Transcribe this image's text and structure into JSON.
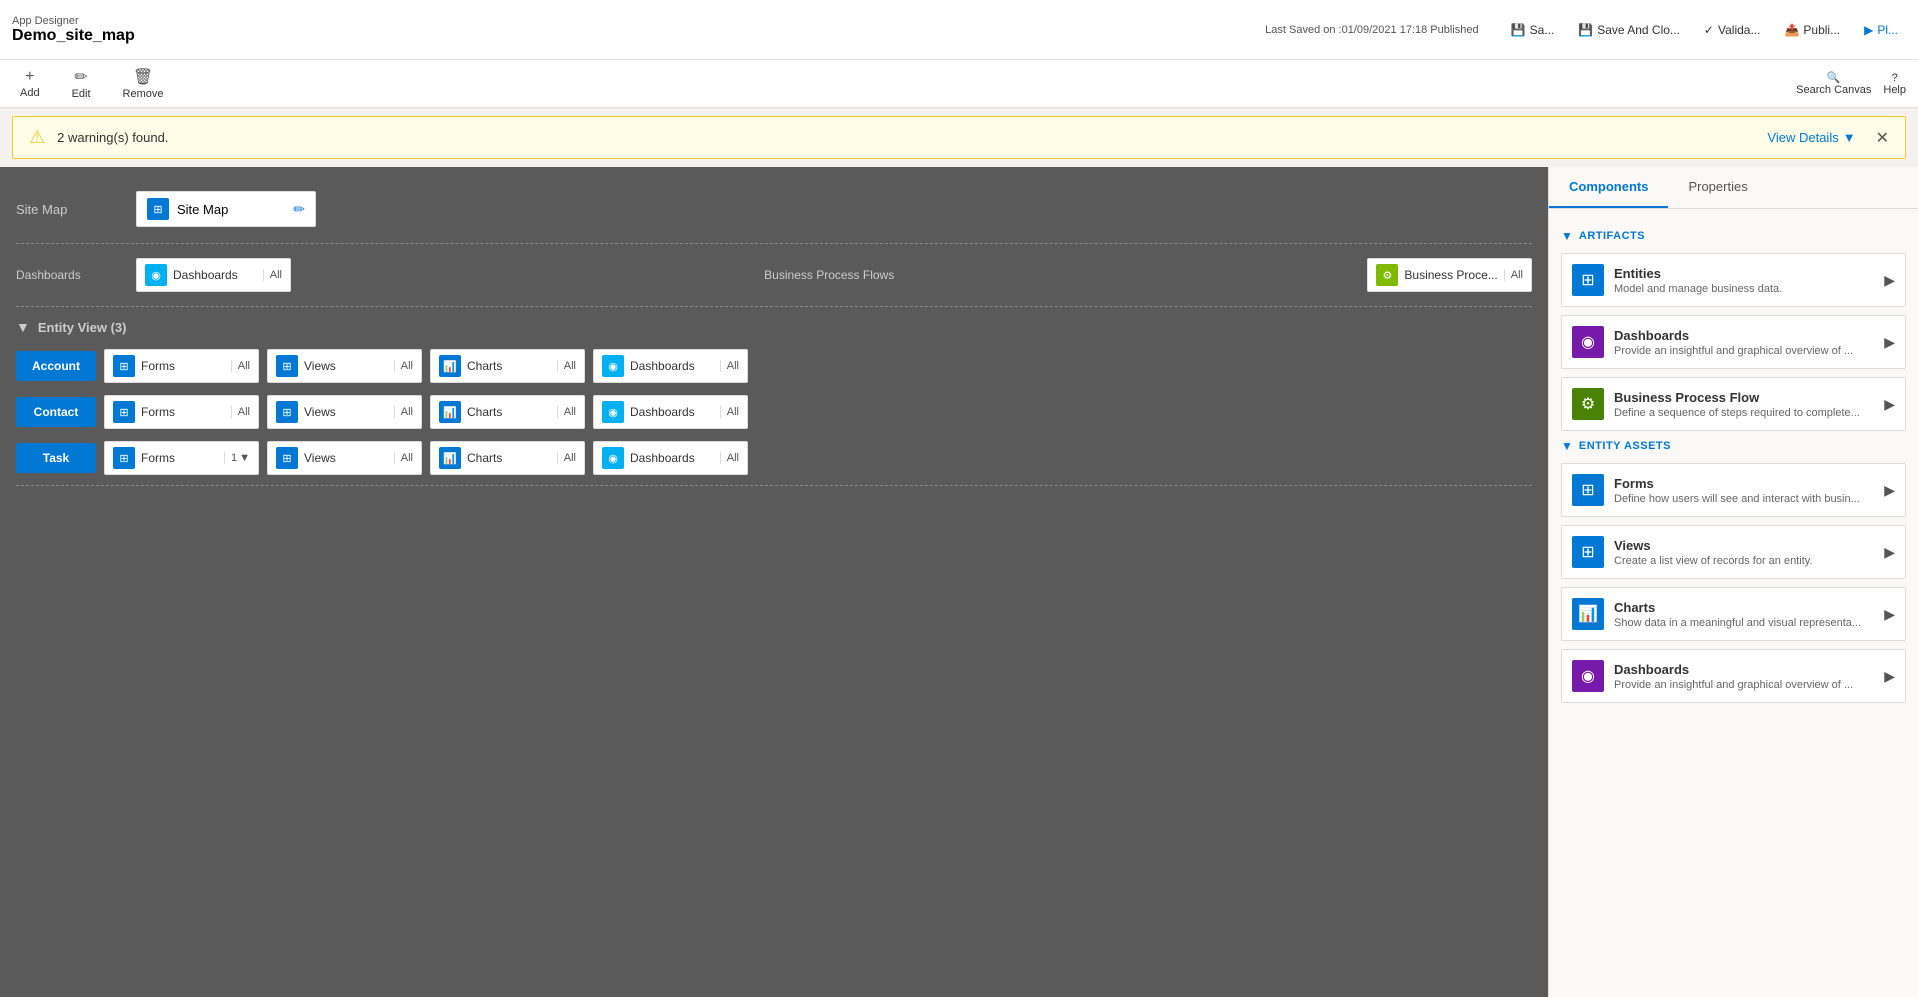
{
  "header": {
    "app_designer_label": "App Designer",
    "title": "Demo_site_map",
    "save_info": "Last Saved on :01/09/2021 17:18 Published",
    "buttons": {
      "save": "Sa...",
      "save_and_close": "Save And Clo...",
      "validate": "Valida...",
      "publish": "Publi...",
      "play": "Pl..."
    }
  },
  "toolbar": {
    "add": "Add",
    "edit": "Edit",
    "remove": "Remove",
    "search_canvas": "Search Canvas",
    "help": "Help"
  },
  "warning": {
    "count": "2 warning(s) found.",
    "view_details": "View Details"
  },
  "canvas": {
    "sitemap_label": "Site Map",
    "sitemap_card_label": "Site Map",
    "dashboards_label": "Dashboards",
    "dashboards_card": "Dashboards",
    "dashboards_badge": "All",
    "bpf_label": "Business Process Flows",
    "bpf_card": "Business Proce...",
    "bpf_badge": "All",
    "entity_view_label": "Entity View (3)",
    "entities": [
      {
        "name": "Account",
        "forms_label": "Forms",
        "forms_badge": "All",
        "views_label": "Views",
        "views_badge": "All",
        "charts_label": "Charts",
        "charts_badge": "All",
        "dashboards_label": "Dashboards",
        "dashboards_badge": "All"
      },
      {
        "name": "Contact",
        "forms_label": "Forms",
        "forms_badge": "All",
        "views_label": "Views",
        "views_badge": "All",
        "charts_label": "Charts",
        "charts_badge": "All",
        "dashboards_label": "Dashboards",
        "dashboards_badge": "All"
      },
      {
        "name": "Task",
        "forms_label": "Forms",
        "forms_badge": "1",
        "forms_has_chevron": true,
        "views_label": "Views",
        "views_badge": "All",
        "charts_label": "Charts",
        "charts_badge": "All",
        "dashboards_label": "Dashboards",
        "dashboards_badge": "All"
      }
    ]
  },
  "right_panel": {
    "tabs": [
      "Components",
      "Properties"
    ],
    "active_tab": "Components",
    "artifacts_section": "ARTIFACTS",
    "entity_assets_section": "ENTITY ASSETS",
    "artifacts": [
      {
        "name": "Entities",
        "desc": "Model and manage business data.",
        "icon_type": "ci-blue",
        "icon_char": "⊞"
      },
      {
        "name": "Dashboards",
        "desc": "Provide an insightful and graphical overview of ...",
        "icon_type": "ci-purple",
        "icon_char": "◉"
      },
      {
        "name": "Business Process Flow",
        "desc": "Define a sequence of steps required to complete...",
        "icon_type": "ci-green",
        "icon_char": "⚙"
      }
    ],
    "entity_assets": [
      {
        "name": "Forms",
        "desc": "Define how users will see and interact with busin...",
        "icon_type": "ci-blue",
        "icon_char": "⊞"
      },
      {
        "name": "Views",
        "desc": "Create a list view of records for an entity.",
        "icon_type": "ci-blue",
        "icon_char": "⊞"
      },
      {
        "name": "Charts",
        "desc": "Show data in a meaningful and visual representa...",
        "icon_type": "ci-blue",
        "icon_char": "📊"
      },
      {
        "name": "Dashboards",
        "desc": "Provide an insightful and graphical overview of ...",
        "icon_type": "ci-purple",
        "icon_char": "◉"
      }
    ]
  },
  "icons": {
    "warning": "⚠",
    "edit_pencil": "✏",
    "chevron_down": "▼",
    "chevron_right": "▶",
    "close": "✕",
    "add": "+",
    "forms": "⊞",
    "views": "⊞",
    "charts": "📊",
    "dashboards": "◉",
    "bpf": "⚙",
    "sitemap": "⊞",
    "search": "🔍",
    "help": "?"
  },
  "colors": {
    "blue": "#0078d4",
    "purple": "#7719aa",
    "green": "#498205",
    "teal": "#00b0f0",
    "yellow": "#f9c928"
  }
}
